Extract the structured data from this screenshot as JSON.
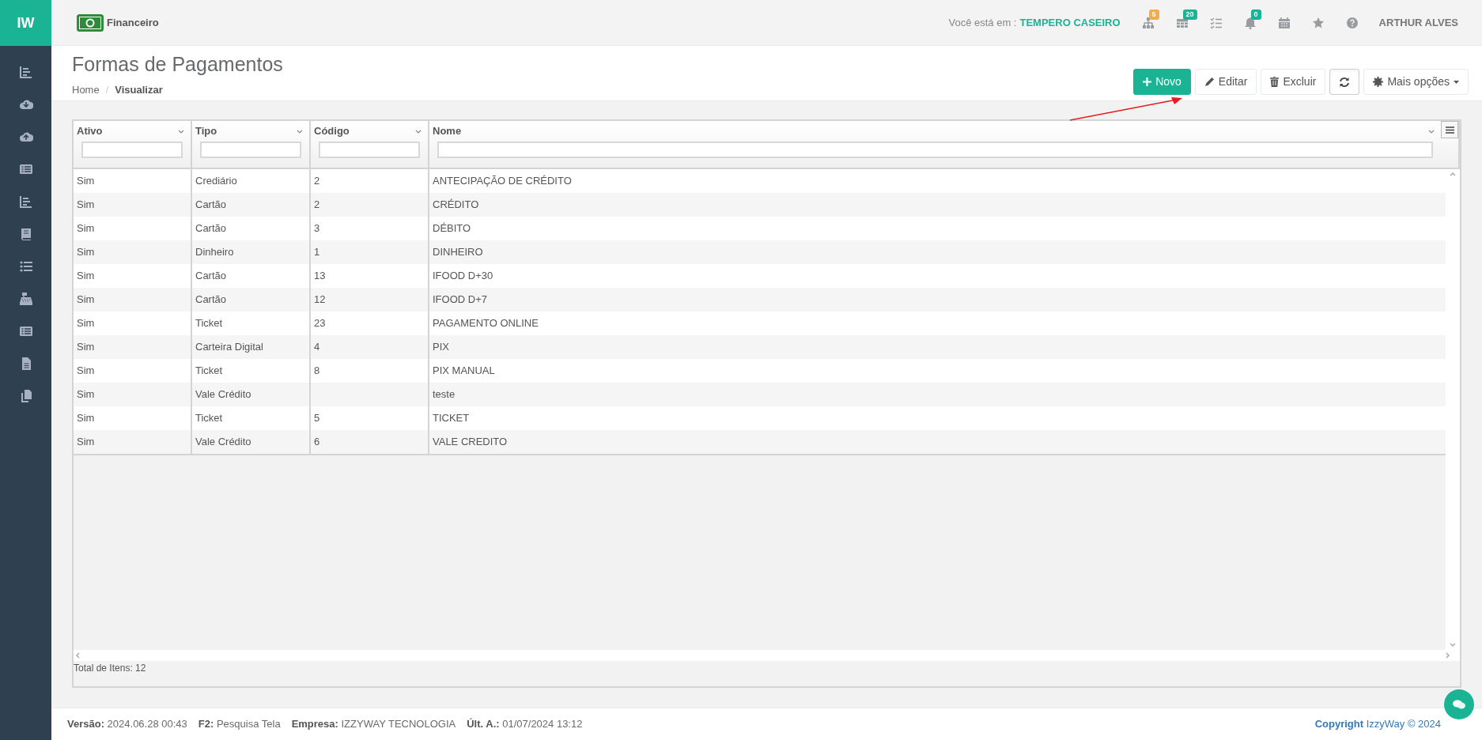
{
  "brand": "IW",
  "module": {
    "title": "Financeiro"
  },
  "topbar": {
    "location_label": "Você está em :",
    "location": "TEMPERO CASEIRO",
    "icons": [
      {
        "kind": "sitemap",
        "badge": "5",
        "color": "#f0ad4e"
      },
      {
        "kind": "table",
        "badge": "20",
        "color": "#1ab394"
      },
      {
        "kind": "checklist"
      },
      {
        "kind": "bell",
        "badge": "0",
        "color": "#1ab394"
      },
      {
        "kind": "calendar"
      },
      {
        "kind": "star"
      },
      {
        "kind": "help"
      }
    ],
    "user": "ARTHUR ALVES"
  },
  "page": {
    "title": "Formas de Pagamentos",
    "breadcrumb_separator": "/",
    "breadcrumb": [
      {
        "label": "Home",
        "selected": false
      },
      {
        "label": "Visualizar",
        "selected": true
      }
    ]
  },
  "toolbar": [
    {
      "kind": "primary",
      "label": "Novo"
    },
    {
      "kind": "edit",
      "label": "Editar"
    },
    {
      "kind": "delete",
      "label": "Excluir"
    },
    {
      "kind": "refresh"
    },
    {
      "kind": "dropdown",
      "label": "Mais opções"
    }
  ],
  "table": {
    "columns": [
      "Ativo",
      "Tipo",
      "Código",
      "Nome"
    ],
    "rows": [
      [
        "Sim",
        "Crediário",
        "2",
        "ANTECIPAÇÃO DE CRÉDITO"
      ],
      [
        "Sim",
        "Cartão",
        "2",
        "CRÉDITO"
      ],
      [
        "Sim",
        "Cartão",
        "3",
        "DÉBITO"
      ],
      [
        "Sim",
        "Dinheiro",
        "1",
        "DINHEIRO"
      ],
      [
        "Sim",
        "Cartão",
        "13",
        "IFOOD D+30"
      ],
      [
        "Sim",
        "Cartão",
        "12",
        "IFOOD D+7"
      ],
      [
        "Sim",
        "Ticket",
        "23",
        "PAGAMENTO ONLINE"
      ],
      [
        "Sim",
        "Carteira Digital",
        "4",
        "PIX"
      ],
      [
        "Sim",
        "Ticket",
        "8",
        "PIX MANUAL"
      ],
      [
        "Sim",
        "Vale Crédito",
        "",
        "teste"
      ],
      [
        "Sim",
        "Ticket",
        "5",
        "TICKET"
      ],
      [
        "Sim",
        "Vale Crédito",
        "6",
        "VALE CREDITO"
      ]
    ],
    "total": "Total de Itens: 12"
  },
  "footer": {
    "items": [
      {
        "label": "Versão:",
        "value": "2024.06.28 00:43"
      },
      {
        "label": "F2:",
        "value": "Pesquisa Tela"
      },
      {
        "label": "Empresa:",
        "value": "IZZYWAY TECNOLOGIA"
      },
      {
        "label": "Últ. A.:",
        "value": "01/07/2024 13:12"
      }
    ],
    "copyright": "**Copyright** IzzyWay © 2024"
  }
}
